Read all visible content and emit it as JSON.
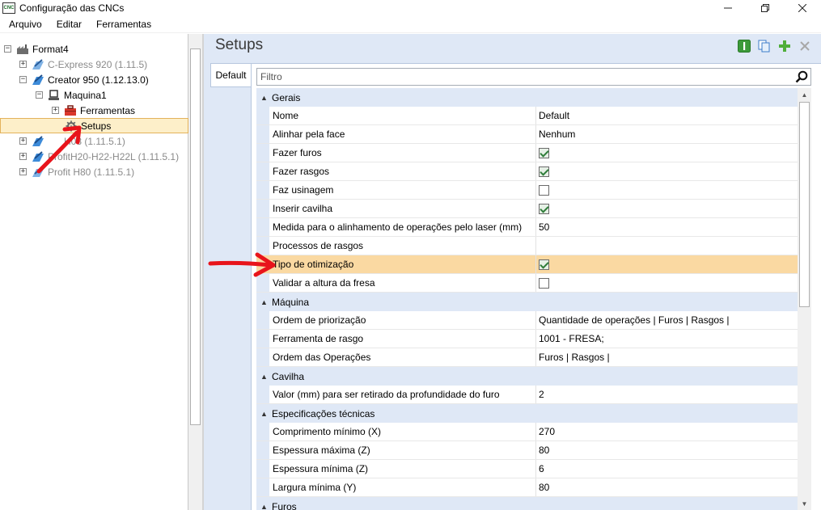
{
  "window": {
    "title": "Configuração das CNCs",
    "app_icon_text": "CNC"
  },
  "menu": [
    "Arquivo",
    "Editar",
    "Ferramentas"
  ],
  "tree": {
    "root": "Format4",
    "items": [
      {
        "label": "C-Express 920 (1.11.5)",
        "muted": true
      },
      {
        "label": "Creator 950 (1.12.13.0)",
        "muted": false
      },
      {
        "label": "Maquina1",
        "muted": false
      },
      {
        "label": "Ferramentas",
        "muted": false
      },
      {
        "label": "Setups",
        "muted": false,
        "selected": true
      },
      {
        "label": "H08 (1.11.5.1)",
        "muted": true
      },
      {
        "label": "H20-H22-H22L (1.11.5.1)",
        "muted": true,
        "prefix": "Profit"
      },
      {
        "label": "Profit H80 (1.11.5.1)",
        "muted": true
      }
    ]
  },
  "panel": {
    "title": "Setups",
    "tab": "Default",
    "filter_placeholder": "Filtro"
  },
  "grid": {
    "categories": [
      {
        "name": "Gerais",
        "rows": [
          {
            "name": "Nome",
            "type": "text",
            "value": "Default"
          },
          {
            "name": "Alinhar pela face",
            "type": "text",
            "value": "Nenhum"
          },
          {
            "name": "Fazer furos",
            "type": "check",
            "checked": true
          },
          {
            "name": "Fazer rasgos",
            "type": "check",
            "checked": true
          },
          {
            "name": "Faz usinagem",
            "type": "check",
            "checked": false
          },
          {
            "name": "Inserir cavilha",
            "type": "check",
            "checked": true
          },
          {
            "name": "Medida para o alinhamento de operações pelo laser (mm)",
            "type": "text",
            "value": "50"
          },
          {
            "name": "Processos de rasgos",
            "type": "text",
            "value": ""
          },
          {
            "name": "Tipo de otimização",
            "type": "check",
            "checked": true,
            "highlight": true
          },
          {
            "name": "Validar a altura da fresa",
            "type": "check",
            "checked": false
          }
        ]
      },
      {
        "name": "Máquina",
        "rows": [
          {
            "name": "Ordem de priorização",
            "type": "text",
            "value": "Quantidade de operações | Furos | Rasgos |"
          },
          {
            "name": "Ferramenta de rasgo",
            "type": "text",
            "value": "1001 - FRESA;"
          },
          {
            "name": "Ordem das Operações",
            "type": "text",
            "value": "Furos | Rasgos |"
          }
        ]
      },
      {
        "name": "Cavilha",
        "rows": [
          {
            "name": "Valor (mm) para ser retirado da profundidade do furo",
            "type": "text",
            "value": "2"
          }
        ]
      },
      {
        "name": "Especificações técnicas",
        "rows": [
          {
            "name": "Comprimento mínimo (X)",
            "type": "text",
            "value": "270"
          },
          {
            "name": "Espessura máxima (Z)",
            "type": "text",
            "value": "80"
          },
          {
            "name": "Espessura mínima (Z)",
            "type": "text",
            "value": "6"
          },
          {
            "name": "Largura mínima (Y)",
            "type": "text",
            "value": "80"
          }
        ]
      },
      {
        "name": "Furos",
        "rows": []
      }
    ]
  },
  "colors": {
    "accent_red": "#e8141b",
    "selection": "#fad9a2",
    "panel_bg": "#dfe8f6",
    "green": "#2f9e3a"
  }
}
